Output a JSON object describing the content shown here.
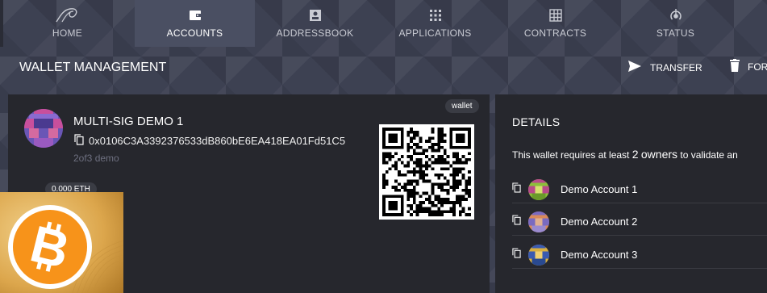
{
  "nav": {
    "items": [
      {
        "label": "HOME",
        "icon": "home-swoosh-icon",
        "active": false
      },
      {
        "label": "ACCOUNTS",
        "icon": "wallet-icon",
        "active": true
      },
      {
        "label": "ADDRESSBOOK",
        "icon": "contact-card-icon",
        "active": false
      },
      {
        "label": "APPLICATIONS",
        "icon": "apps-grid-icon",
        "active": false
      },
      {
        "label": "CONTRACTS",
        "icon": "table-grid-icon",
        "active": false
      },
      {
        "label": "STATUS",
        "icon": "status-signal-icon",
        "active": false
      }
    ]
  },
  "header": {
    "title": "WALLET MANAGEMENT",
    "transfer_label": "TRANSFER",
    "forget_label": "FOR"
  },
  "wallet": {
    "tag": "wallet",
    "name": "MULTI-SIG DEMO 1",
    "address": "0x0106C3A3392376533dB860bE6EA418EA01Fd51C5",
    "subtitle": "2of3 demo",
    "balance": "0.000 ETH"
  },
  "details": {
    "title": "DETAILS",
    "text_before": "This wallet requires at least",
    "required_count": "2",
    "owners_word": "owners",
    "text_after": "to validate an",
    "owners": [
      {
        "name": "Demo Account 1"
      },
      {
        "name": "Demo Account 2"
      },
      {
        "name": "Demo Account 3"
      }
    ]
  },
  "colors": {
    "background": "#3d4152",
    "panel": "#26272d",
    "active_tab": "#4a4f62",
    "bitcoin_orange": "#f7931a"
  }
}
